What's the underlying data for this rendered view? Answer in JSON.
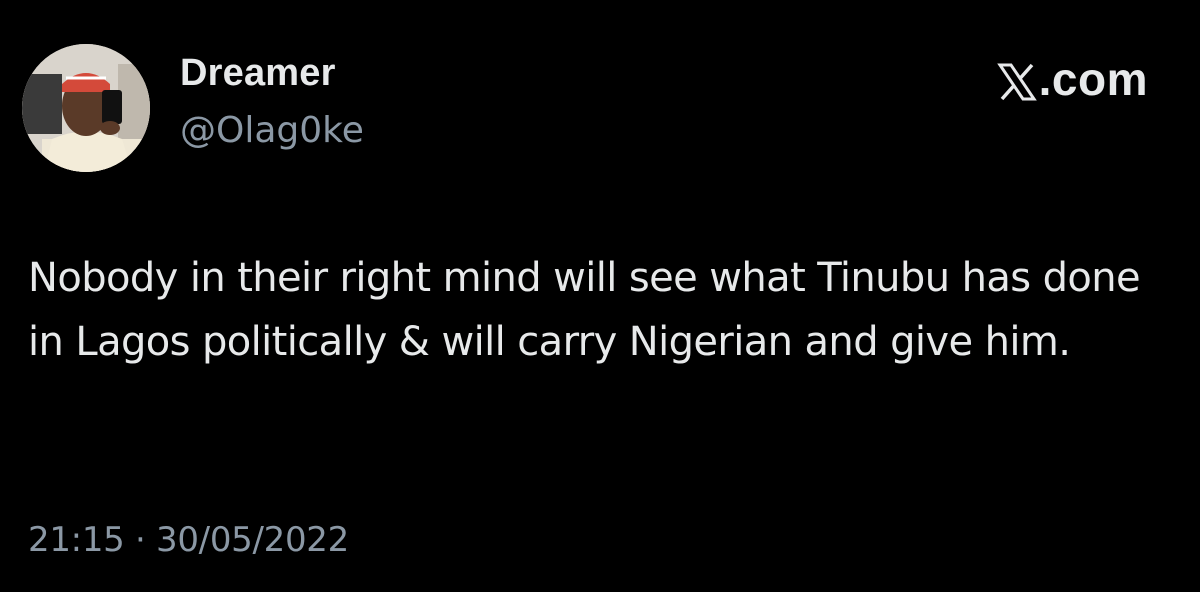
{
  "author": {
    "display_name": "Dreamer",
    "handle": "@Olag0ke",
    "avatar_icon": "profile-photo"
  },
  "source": {
    "label": ".com",
    "icon": "x-logo-icon"
  },
  "tweet": {
    "text": "Nobody in their right mind will see what Tinubu has done in Lagos politically & will carry Nigerian and give him.",
    "timestamp": "21:15 · 30/05/2022"
  },
  "colors": {
    "background": "#000000",
    "primary_text": "#e7e9ea",
    "secondary_text": "#8b98a5"
  }
}
